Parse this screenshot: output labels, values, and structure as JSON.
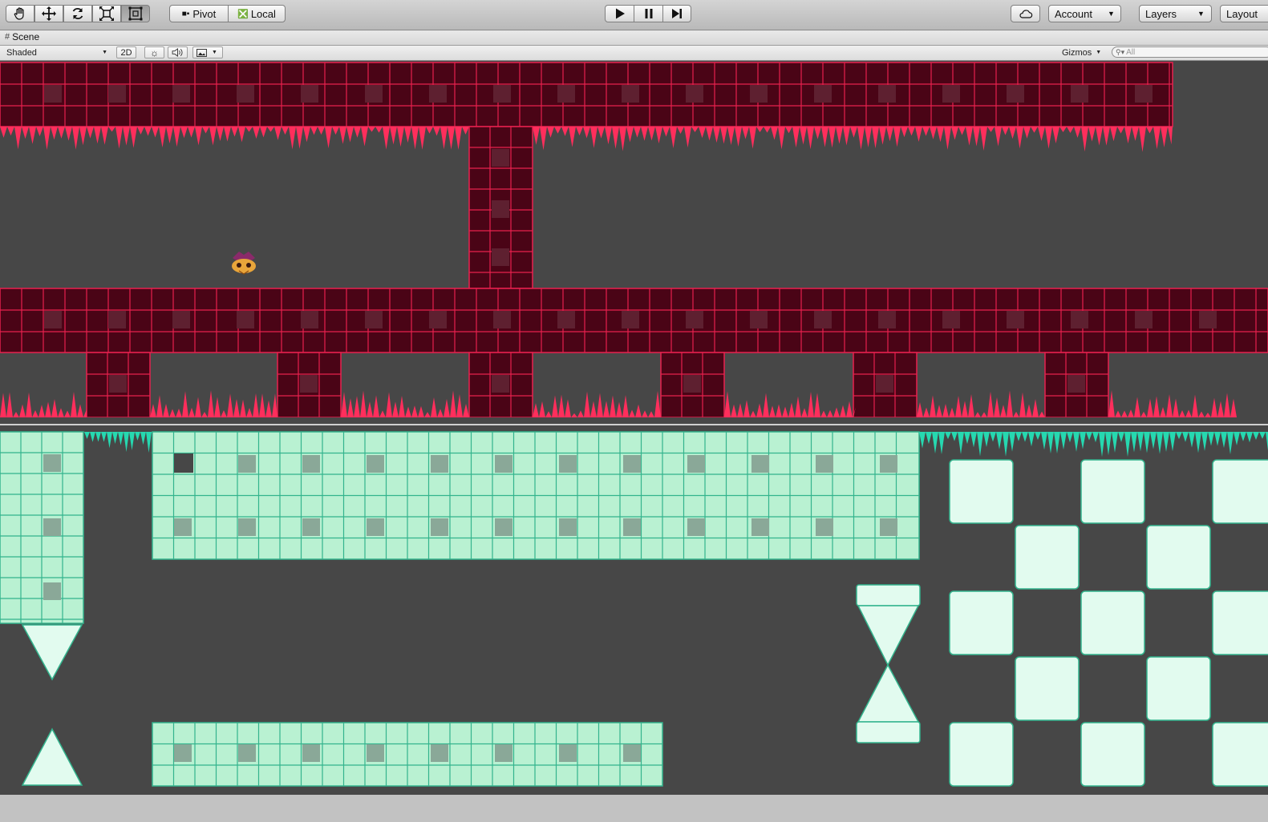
{
  "toolbar": {
    "tools": [
      {
        "name": "hand-tool",
        "icon": "hand-icon",
        "selected": false
      },
      {
        "name": "move-tool",
        "icon": "move-arrows-icon",
        "selected": false
      },
      {
        "name": "rotate-tool",
        "icon": "rotate-icon",
        "selected": false
      },
      {
        "name": "scale-tool",
        "icon": "scale-icon",
        "selected": false
      },
      {
        "name": "rect-tool",
        "icon": "rect-transform-icon",
        "selected": true
      }
    ],
    "pivot_label": "Pivot",
    "local_label": "Local",
    "playback": [
      "play-icon",
      "pause-icon",
      "step-icon"
    ],
    "cloud_icon": "cloud-icon",
    "account_label": "Account",
    "layers_label": "Layers",
    "layout_label": "Layout"
  },
  "tab": {
    "label": "Scene",
    "icon": "scene-grid-icon"
  },
  "scene_bar": {
    "draw_mode": "Shaded",
    "mode_2d": "2D",
    "lighting_icon": "sun-icon",
    "audio_icon": "speaker-icon",
    "effects_icon": "image-icon",
    "gizmos_label": "Gizmos",
    "search_placeholder": "All"
  },
  "colors": {
    "viewport_bg": "#474747",
    "red_tile_fill": "#4a0416",
    "red_tile_line": "#e8204e",
    "red_spikes": "#ff2e5c",
    "green_tile_fill": "#b9f1d2",
    "green_tile_line": "#33b48d",
    "green_spikes": "#26d8b0",
    "green_block": "#e2fbef"
  }
}
